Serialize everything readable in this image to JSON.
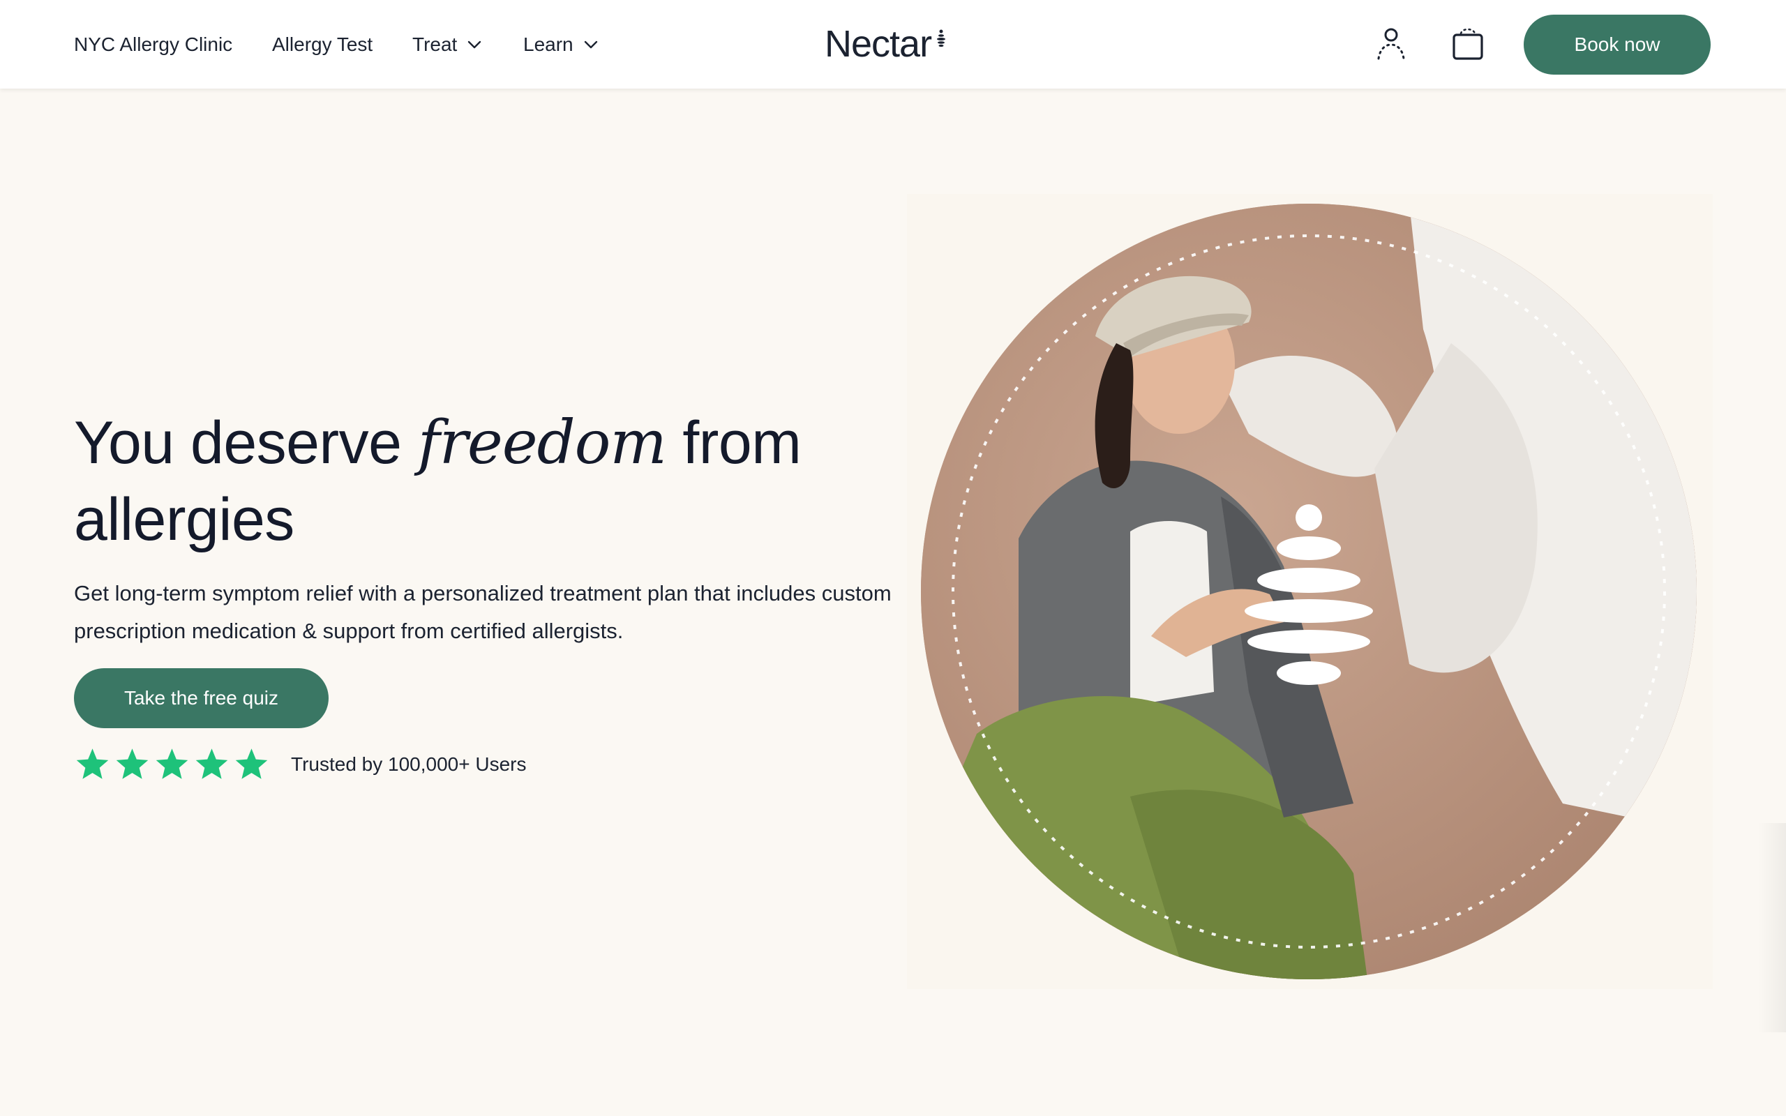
{
  "nav": {
    "links": [
      {
        "label": "NYC Allergy Clinic"
      },
      {
        "label": "Allergy Test"
      },
      {
        "label": "Treat",
        "icon": "chevron-down-icon"
      },
      {
        "label": "Learn",
        "icon": "chevron-down-icon"
      }
    ],
    "logo": "Nectar",
    "account_icon": "account-icon",
    "cart_icon": "cart-icon",
    "book_label": "Book now"
  },
  "hero": {
    "title_part1": "You deserve ",
    "title_em": "freedom",
    "title_part2": " from allergies",
    "subtitle": "Get long-term symptom relief with a personalized treatment plan that includes custom prescription medication & support from certified allergists.",
    "cta_label": "Take the free quiz",
    "rating_stars": 5,
    "trust_text": "Trusted by 100,000+ Users"
  },
  "colors": {
    "accent": "#3a7764",
    "star": "#1ec27a",
    "background": "#fbf8f3",
    "text": "#141a2b"
  }
}
